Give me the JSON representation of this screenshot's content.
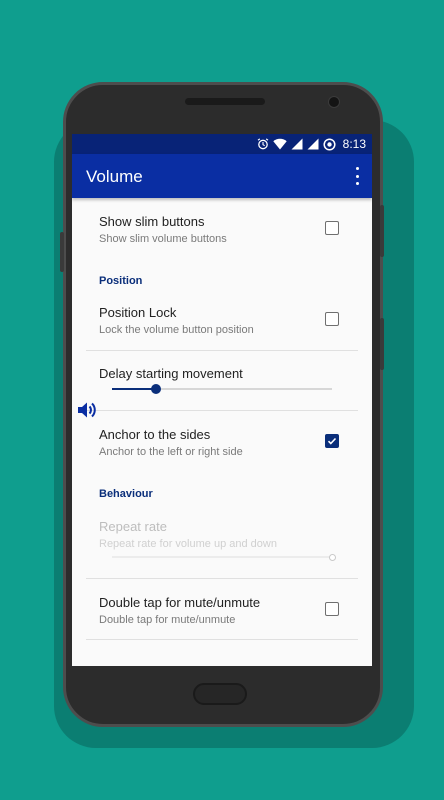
{
  "status": {
    "time": "8:13",
    "icons": [
      "alarm-icon",
      "wifi-icon",
      "signal-icon",
      "signal-icon",
      "sync-icon"
    ]
  },
  "appbar": {
    "title": "Volume",
    "menu_icon": "overflow-menu-icon"
  },
  "prefs": {
    "slim": {
      "title": "Show slim buttons",
      "summary": "Show slim volume buttons",
      "checked": false
    },
    "position_header": "Position",
    "lock": {
      "title": "Position Lock",
      "summary": "Lock the volume button position",
      "checked": false
    },
    "delay": {
      "title": "Delay starting movement",
      "value": 0.2
    },
    "anchor": {
      "title": "Anchor to the sides",
      "summary": "Anchor to the left or right side",
      "checked": true
    },
    "behaviour_header": "Behaviour",
    "repeat": {
      "title": "Repeat rate",
      "summary": "Repeat rate for volume up and down",
      "value": 1.0,
      "enabled": false
    },
    "double_tap": {
      "title": "Double tap for mute/unmute",
      "summary": "Double tap for mute/unmute",
      "checked": false
    }
  },
  "floating_button_icon": "volume-speaker-icon",
  "colors": {
    "background": "#0f9e8e",
    "statusbar": "#082377",
    "appbar": "#0a2ea3",
    "accent": "#0a2e7a"
  }
}
